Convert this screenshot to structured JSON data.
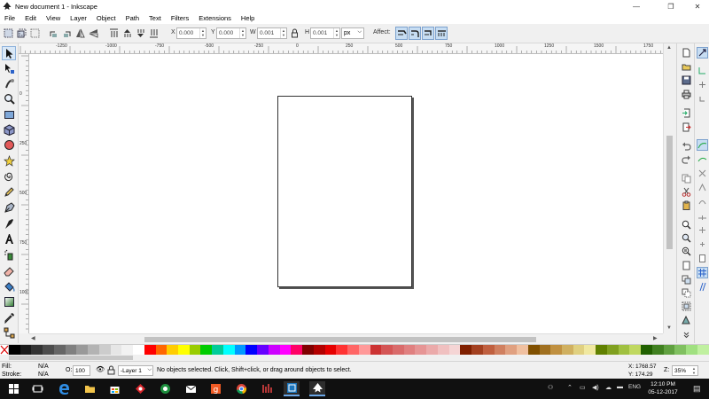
{
  "window": {
    "title": "New document 1 - Inkscape",
    "minimize": "—",
    "restore": "❐",
    "close": "✕"
  },
  "menu": [
    "File",
    "Edit",
    "View",
    "Layer",
    "Object",
    "Path",
    "Text",
    "Filters",
    "Extensions",
    "Help"
  ],
  "tool_controls": {
    "x_label": "X",
    "x_value": "0.000",
    "y_label": "Y",
    "y_value": "0.000",
    "w_label": "W",
    "w_value": "0.001",
    "h_label": "H",
    "h_value": "0.001",
    "unit": "px",
    "affect_label": "Affect:"
  },
  "ruler": {
    "top_labels": [
      "-1250",
      "-1000",
      "-750",
      "-500",
      "-250",
      "0",
      "250",
      "500",
      "750",
      "1000",
      "1250",
      "1500",
      "1750"
    ],
    "left_labels": [
      "0",
      "250",
      "500",
      "750",
      "1000",
      "1250"
    ]
  },
  "palette": {
    "colors": [
      "#000000",
      "#1a1a1a",
      "#333333",
      "#4d4d4d",
      "#666666",
      "#808080",
      "#999999",
      "#b3b3b3",
      "#cccccc",
      "#e6e6e6",
      "#f2f2f2",
      "#ffffff",
      "#ff0000",
      "#ff6600",
      "#ffcc00",
      "#ffff00",
      "#99cc00",
      "#00cc00",
      "#00cc99",
      "#00ffff",
      "#0099ff",
      "#0000ff",
      "#6600ff",
      "#cc00ff",
      "#ff00ff",
      "#ff0066",
      "#800000",
      "#b30000",
      "#e60000",
      "#ff3333",
      "#ff6666",
      "#ff9999",
      "#cc3333",
      "#d45555",
      "#d96b6b",
      "#e08080",
      "#e69595",
      "#ebaaaa",
      "#f0c0c0",
      "#f5d5d5",
      "#802000",
      "#a34020",
      "#c06040",
      "#d08060",
      "#e0a080",
      "#f0c0a0",
      "#805000",
      "#a07020",
      "#c09040",
      "#d0b060",
      "#e0d080",
      "#f0e8a0",
      "#608000",
      "#80a020",
      "#a0c040",
      "#c0d860",
      "#206000",
      "#408020",
      "#60a040",
      "#80c060",
      "#a0e080",
      "#c0f0a0"
    ]
  },
  "status": {
    "fill_label": "Fill:",
    "fill_value": "N/A",
    "stroke_label": "Stroke:",
    "stroke_value": "N/A",
    "opacity_label": "O:",
    "opacity_value": "100",
    "layer": "-Layer 1",
    "message": "No objects selected. Click, Shift+click, or drag around objects to select.",
    "x_coord": "X: 1768.57",
    "y_coord": "Y: 174.29",
    "zoom_label": "Z:",
    "zoom_value": "35%"
  },
  "taskbar": {
    "time": "12:10 PM",
    "date": "05-12-2017",
    "lang": "ENG"
  }
}
